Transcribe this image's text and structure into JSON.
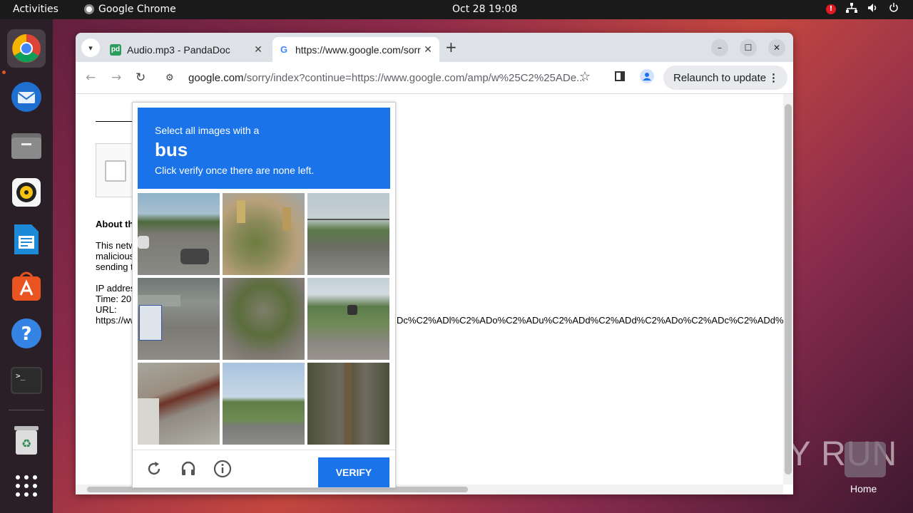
{
  "topbar": {
    "activities": "Activities",
    "app_name": "Google Chrome",
    "clock": "Oct 28  19:08",
    "alert": "!"
  },
  "dock": {
    "items": [
      "chrome-icon",
      "thunderbird-icon",
      "files-icon",
      "rhythmbox-icon",
      "writer-icon",
      "app-center-icon",
      "help-icon",
      "terminal-icon",
      "trash-icon",
      "show-apps-icon"
    ]
  },
  "desktop": {
    "home_label": "Home",
    "watermark": "ANY RUN"
  },
  "browser": {
    "tabs": [
      {
        "title": "Audio.mp3 - PandaDoc",
        "favicon": "pd"
      },
      {
        "title": "https://www.google.com/sorry/",
        "favicon": "G"
      }
    ],
    "url_host": "google.com",
    "url_path": "/sorry/index?continue=https://www.google.com/amp/w%25C2%25ADe...",
    "relaunch": "Relaunch to update",
    "accent": "#1a73e8"
  },
  "page": {
    "about": "About th",
    "para1": "This netw",
    "para2": "malicious",
    "para3": "sending t",
    "ip": "IP addres",
    "time": "Time: 20",
    "url_label": "URL:",
    "url_left": "https://ww",
    "url_right": "Dc%C2%ADl%C2%ADo%C2%ADu%C2%ADd%C2%ADd%C2%ADo%C2%ADc%C2%ADd%"
  },
  "captcha": {
    "prompt_line1": "Select all images with a",
    "target": "bus",
    "prompt_line2": "Click verify once there are none left.",
    "verify": "VERIFY",
    "tiles": [
      "road-with-cars",
      "traffic-light-tree",
      "road-with-trees",
      "bus-overpass",
      "noisy-street",
      "road-with-car",
      "building-roof",
      "grassy-field",
      "pole-closeup"
    ]
  }
}
